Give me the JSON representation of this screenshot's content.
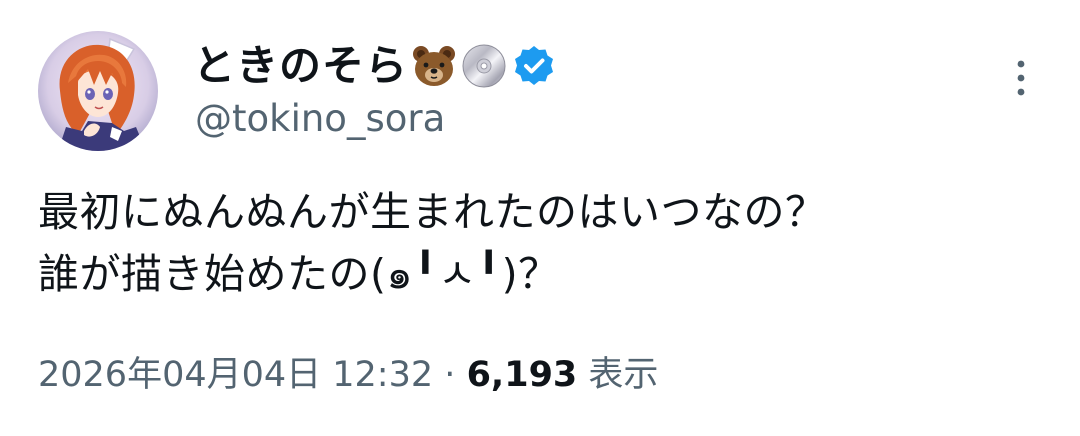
{
  "author": {
    "display_name": "ときのそら",
    "handle": "@tokino_sora",
    "name_emoji_icons": [
      "bear-face-emoji-icon",
      "optical-disc-emoji-icon"
    ],
    "verified_icon": "verified-badge-icon",
    "verified_color": "#1d9bf0"
  },
  "tweet": {
    "lines": [
      "最初にぬんぬんが生まれたのはいつなの？",
      "誰が描き始めたの(๑╹ㅅ╹)？"
    ]
  },
  "meta": {
    "timestamp": "2026年04月04日 12:32",
    "separator": "·",
    "views_count": "6,193",
    "views_label": "表示"
  },
  "menu": {
    "icon": "more-vertical-icon"
  },
  "colors": {
    "text_primary": "#0f1419",
    "text_secondary": "#536471",
    "accent": "#1d9bf0"
  }
}
